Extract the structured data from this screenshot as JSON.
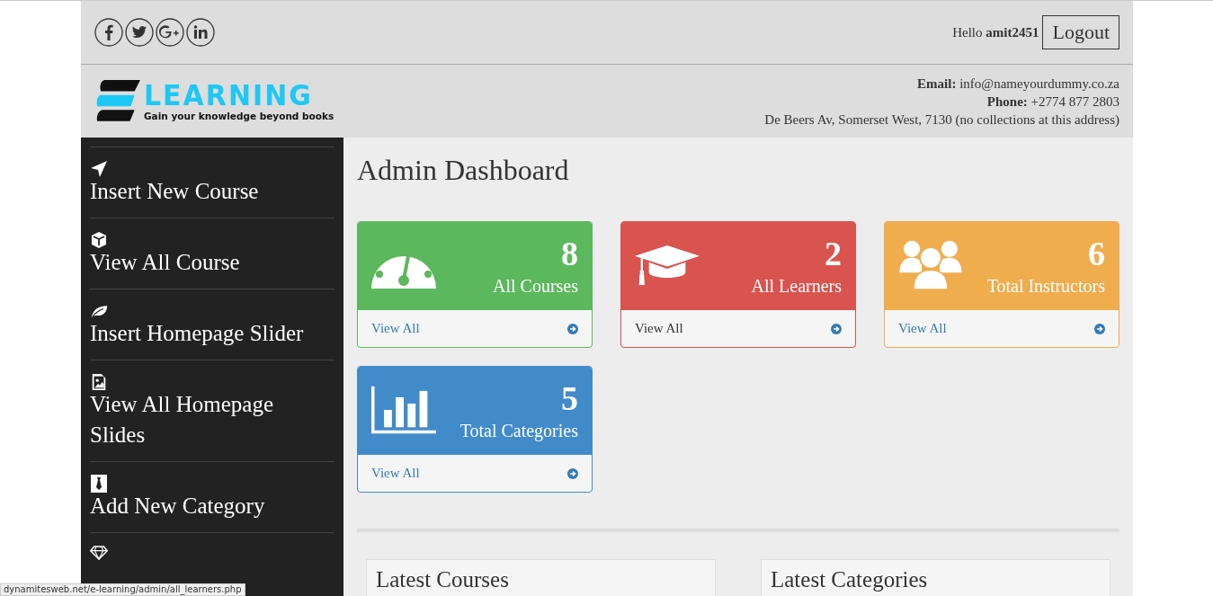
{
  "topbar": {
    "greeting": "Hello",
    "username": "amit2451",
    "logout": "Logout"
  },
  "logo": {
    "title": "LEARNING",
    "tagline": "Gain your knowledge beyond books"
  },
  "contact": {
    "email_label": "Email:",
    "email": "info@nameyourdummy.co.za",
    "phone_label": "Phone:",
    "phone": "+2774 877 2803",
    "address": "De Beers Av, Somerset West, 7130 (no collections at this address)"
  },
  "sidebar": {
    "items": [
      {
        "label": "Insert New Course"
      },
      {
        "label": "View All Course"
      },
      {
        "label": "Insert Homepage Slider"
      },
      {
        "label": "View All Homepage Slides"
      },
      {
        "label": "Add New Category"
      },
      {
        "kind": "icon-only"
      }
    ]
  },
  "main": {
    "title": "Admin Dashboard",
    "cards": [
      {
        "value": "8",
        "label": "All Courses",
        "link": "View All",
        "color": "#5cb85c"
      },
      {
        "value": "2",
        "label": "All Learners",
        "link": "View All",
        "color": "#d9534f"
      },
      {
        "value": "6",
        "label": "Total Instructors",
        "link": "View All",
        "color": "#f0ad4e"
      },
      {
        "value": "5",
        "label": "Total Categories",
        "link": "View All",
        "color": "#428bca"
      }
    ],
    "panels": [
      {
        "title": "Latest Courses"
      },
      {
        "title": "Latest Categories"
      }
    ]
  },
  "status_bar": {
    "url": "dynamitesweb.net/e-learning/admin/all_learners.php"
  }
}
